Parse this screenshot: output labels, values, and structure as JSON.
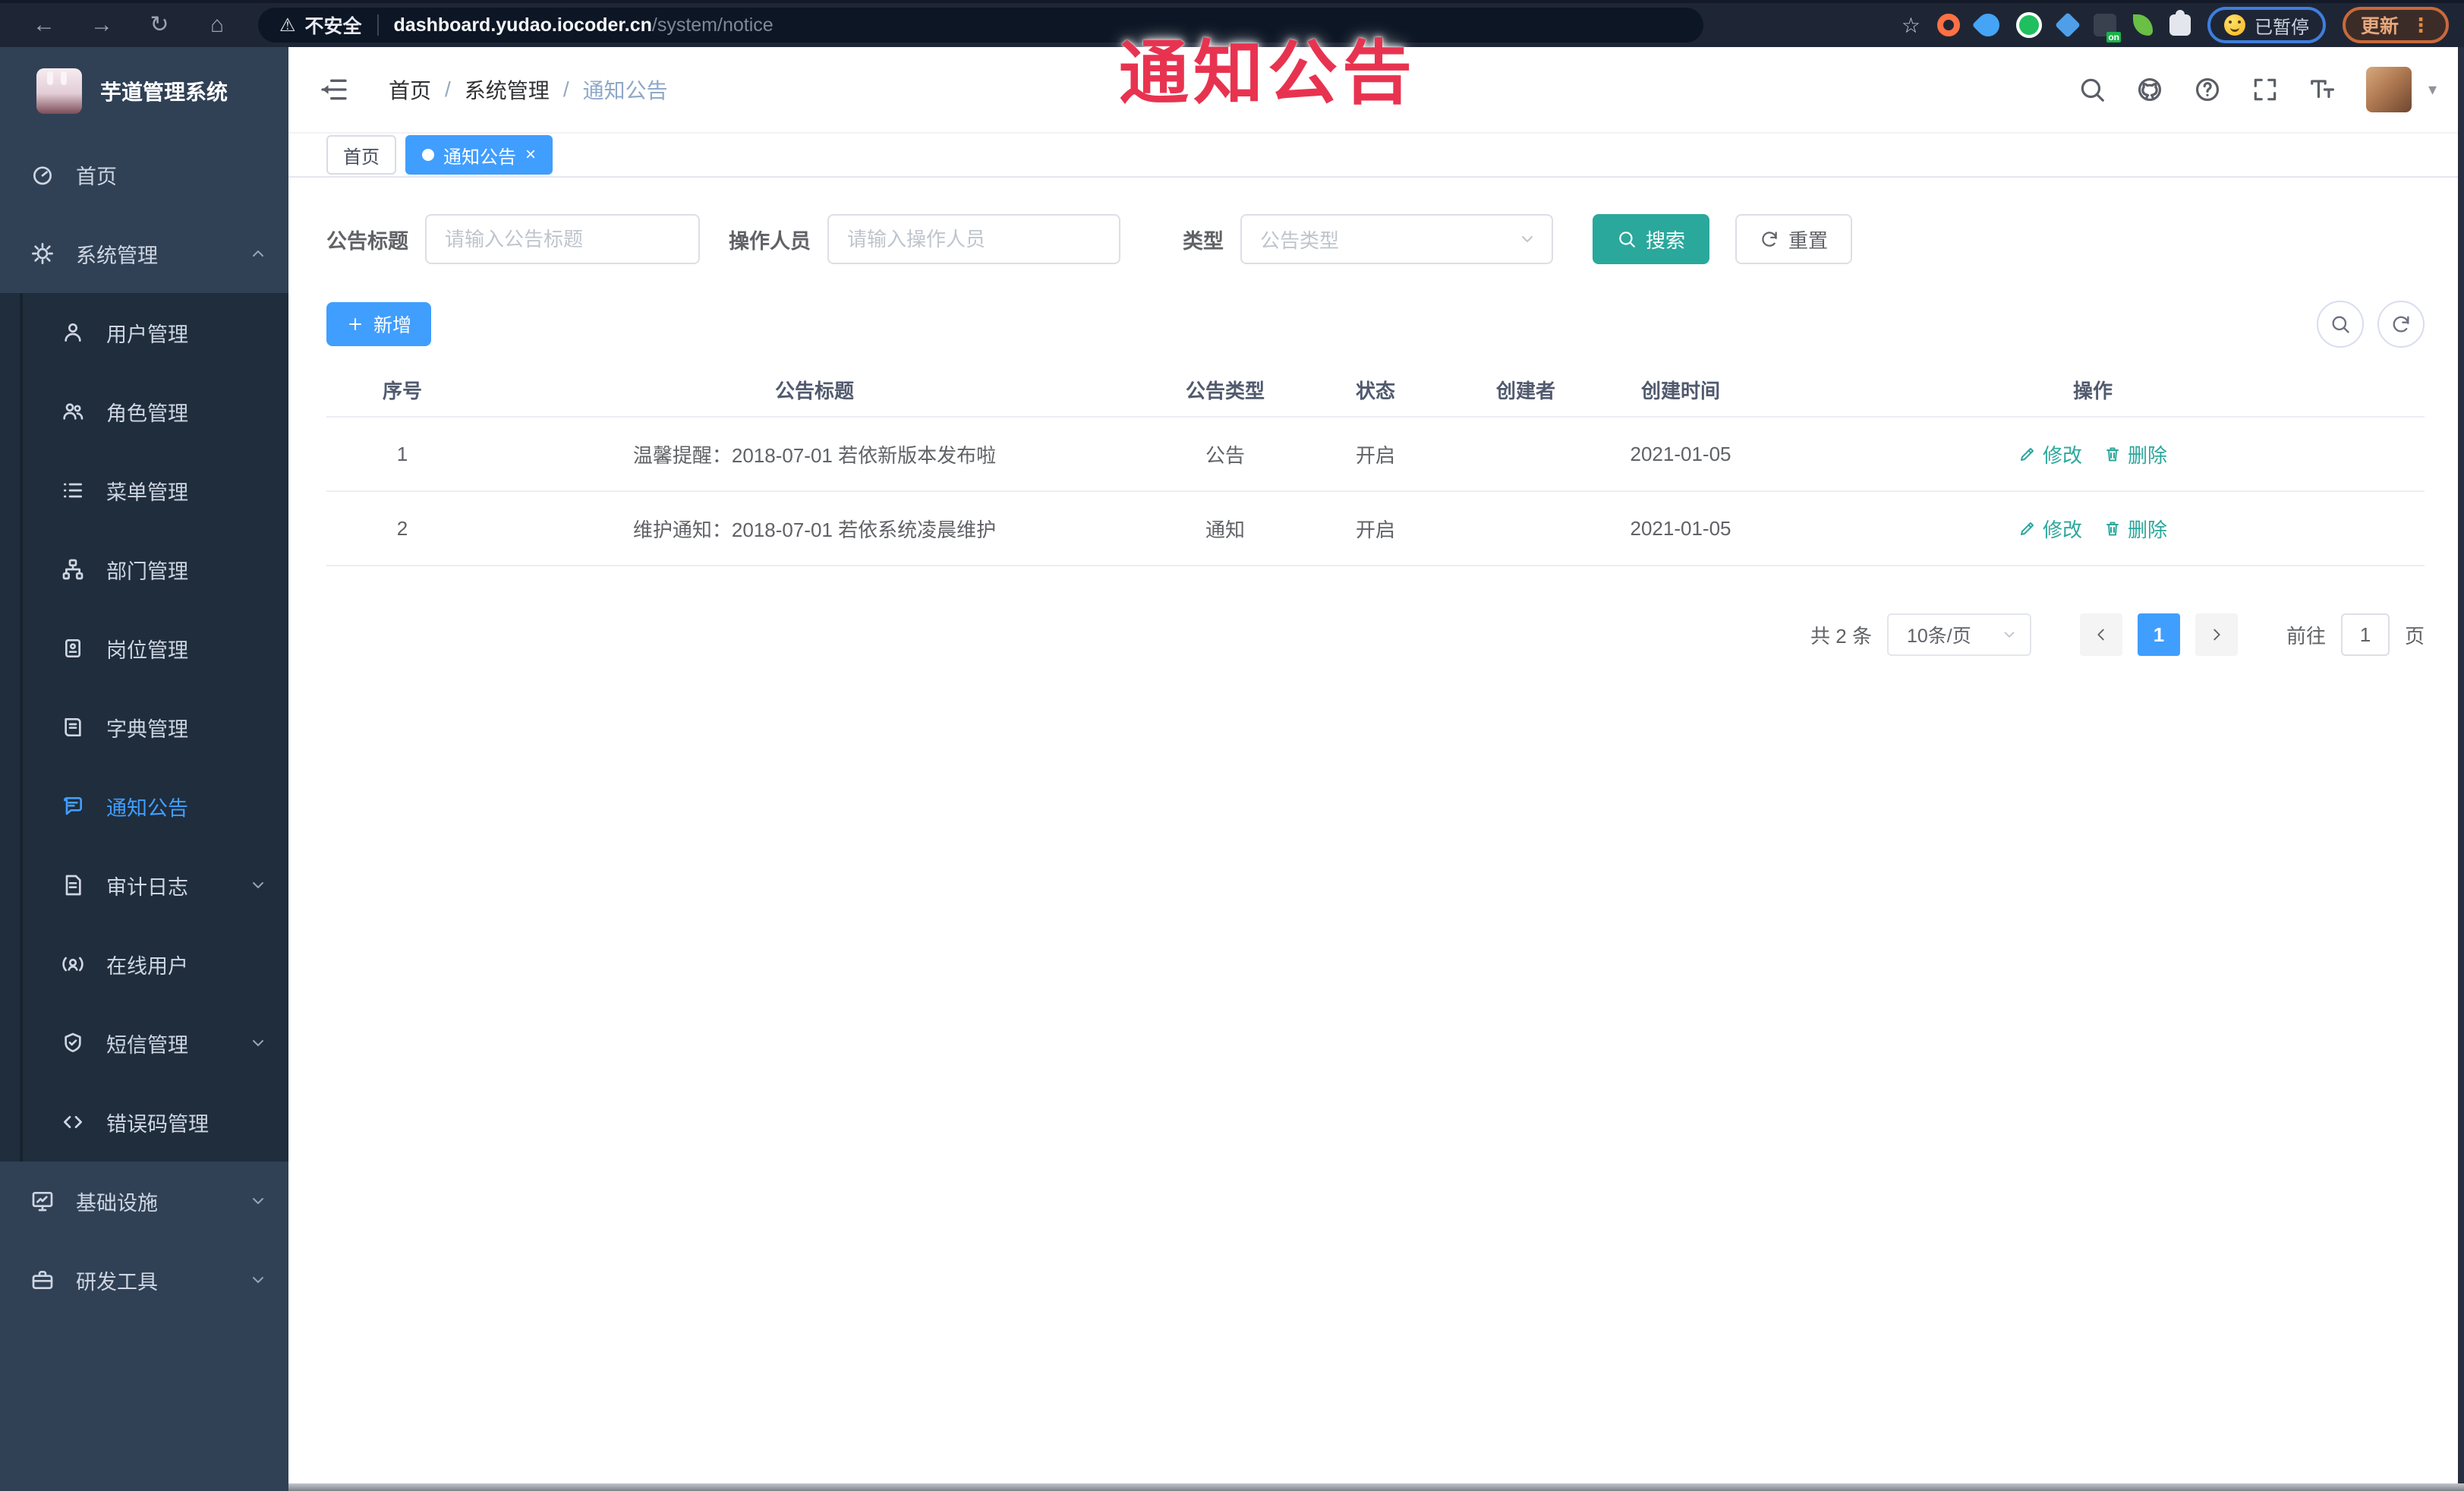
{
  "annotation": {
    "text": "通知公告"
  },
  "browser": {
    "security_label": "不安全",
    "url_host": "dashboard.yudao.iocoder.cn",
    "url_path": "/system/notice",
    "paused_badge": "已暂停",
    "update_button": "更新",
    "extension_on_badge": "on"
  },
  "icons": {
    "back": "←",
    "forward": "→",
    "reload": "↻",
    "home": "⌂",
    "warning": "⚠",
    "bookmark": "☆",
    "overflow_menu": "⋮",
    "caret_down": "▾",
    "tab_close": "×"
  },
  "sidebar": {
    "title": "芋道管理系统",
    "items": [
      {
        "label": "首页"
      },
      {
        "label": "系统管理",
        "expanded": true
      },
      {
        "label": "用户管理"
      },
      {
        "label": "角色管理"
      },
      {
        "label": "菜单管理"
      },
      {
        "label": "部门管理"
      },
      {
        "label": "岗位管理"
      },
      {
        "label": "字典管理"
      },
      {
        "label": "通知公告",
        "active": true
      },
      {
        "label": "审计日志",
        "collapsible": true
      },
      {
        "label": "在线用户"
      },
      {
        "label": "短信管理",
        "collapsible": true
      },
      {
        "label": "错误码管理"
      },
      {
        "label": "基础设施",
        "collapsible": true
      },
      {
        "label": "研发工具",
        "collapsible": true
      }
    ]
  },
  "breadcrumb": {
    "items": [
      "首页",
      "系统管理",
      "通知公告"
    ],
    "separator": "/"
  },
  "tags": {
    "home": "首页",
    "active": "通知公告"
  },
  "filters": {
    "title_label": "公告标题",
    "title_placeholder": "请输入公告标题",
    "operator_label": "操作人员",
    "operator_placeholder": "请输入操作人员",
    "type_label": "类型",
    "type_placeholder": "公告类型",
    "search_button": "搜索",
    "reset_button": "重置"
  },
  "toolbar": {
    "add_button": "新增"
  },
  "table": {
    "headers": [
      "序号",
      "公告标题",
      "公告类型",
      "状态",
      "创建者",
      "创建时间",
      "操作"
    ],
    "rows": [
      {
        "no": "1",
        "title": "温馨提醒：2018-07-01 若依新版本发布啦",
        "type": "公告",
        "status": "开启",
        "creator": "",
        "created_at": "2021-01-05"
      },
      {
        "no": "2",
        "title": "维护通知：2018-07-01 若依系统凌晨维护",
        "type": "通知",
        "status": "开启",
        "creator": "",
        "created_at": "2021-01-05"
      }
    ],
    "edit_action": "修改",
    "delete_action": "删除"
  },
  "pagination": {
    "total": "共 2 条",
    "page_size": "10条/页",
    "current_page": "1",
    "goto_label": "前往",
    "goto_value": "1",
    "unit_label": "页"
  },
  "colors": {
    "primary": "#409eff",
    "teal": "#2aa89c",
    "sidebar_bg": "#304156",
    "submenu_bg": "#1f2d3d",
    "annotation_red": "#e83350"
  }
}
